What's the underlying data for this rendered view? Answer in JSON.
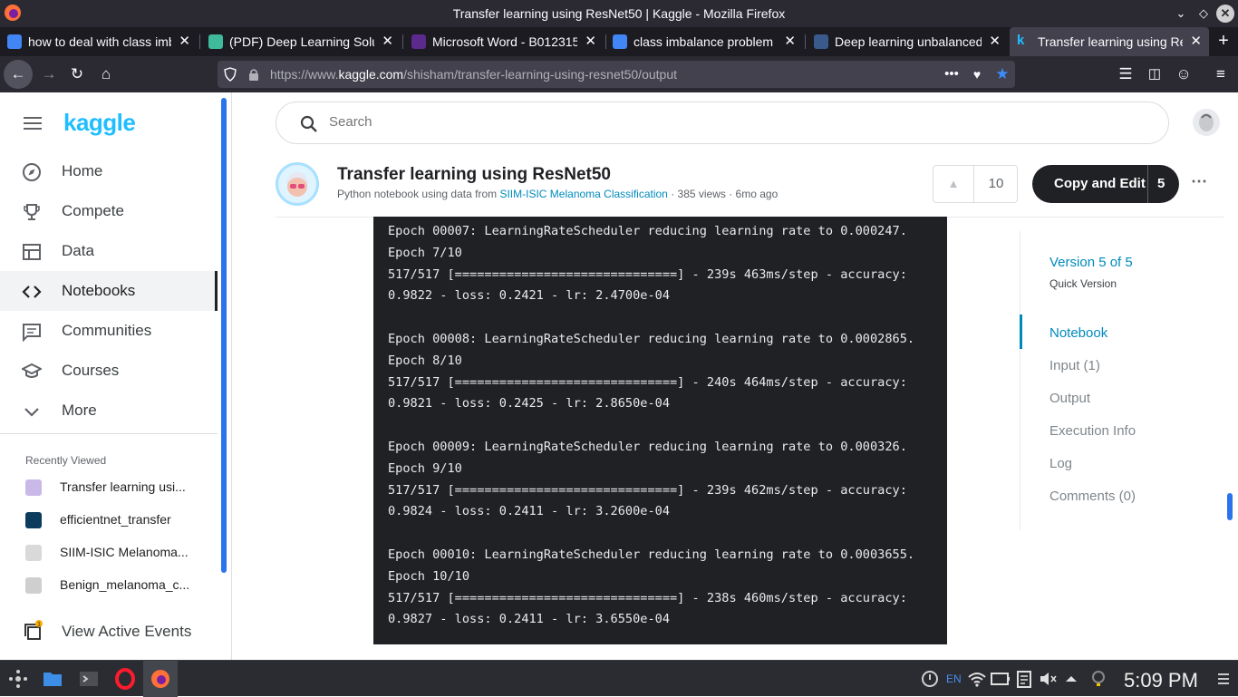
{
  "window": {
    "title": "Transfer learning using ResNet50 | Kaggle - Mozilla Firefox"
  },
  "tabs": [
    {
      "label": "how to deal with class imb",
      "favicon_color": "#4285f4",
      "active": false
    },
    {
      "label": "(PDF) Deep Learning Solut",
      "favicon_color": "#40ba9c",
      "active": false
    },
    {
      "label": "Microsoft Word - B012315",
      "favicon_color": "#5b2a8c",
      "active": false
    },
    {
      "label": "class imbalance problem i",
      "favicon_color": "#4285f4",
      "active": false
    },
    {
      "label": "Deep learning unbalanced",
      "favicon_color": "#3a5a8c",
      "active": false
    },
    {
      "label": "Transfer learning using Re",
      "favicon_color": "#20beff",
      "active": true
    }
  ],
  "navbar": {
    "url_prefix": "https://www.",
    "url_domain": "kaggle.com",
    "url_path": "/shisham/transfer-learning-using-resnet50/output"
  },
  "sidebar": {
    "logo": "kaggle",
    "items": [
      {
        "label": "Home",
        "icon": "compass-icon",
        "active": false
      },
      {
        "label": "Compete",
        "icon": "trophy-icon",
        "active": false
      },
      {
        "label": "Data",
        "icon": "table-icon",
        "active": false
      },
      {
        "label": "Notebooks",
        "icon": "code-icon",
        "active": true
      },
      {
        "label": "Communities",
        "icon": "chat-icon",
        "active": false
      },
      {
        "label": "Courses",
        "icon": "school-icon",
        "active": false
      },
      {
        "label": "More",
        "icon": "chevron-down-icon",
        "active": false
      }
    ],
    "recently_viewed_title": "Recently Viewed",
    "recently_viewed": [
      {
        "label": "Transfer learning usi...",
        "thumb_color": "#c9b8e8"
      },
      {
        "label": "efficientnet_transfer",
        "thumb_color": "#0b3c5d"
      },
      {
        "label": "SIIM-ISIC Melanoma...",
        "thumb_color": "#d9d9d9"
      },
      {
        "label": "Benign_melanoma_c...",
        "thumb_color": "#cfcfcf"
      }
    ],
    "events_label": "View Active Events",
    "events_badge": "1"
  },
  "search": {
    "placeholder": "Search"
  },
  "notebook": {
    "title": "Transfer learning using ResNet50",
    "subtitle_prefix": "Python notebook using data from",
    "dataset_link": "SIIM-ISIC Melanoma Classification",
    "subtitle_suffix": "· 385 views · 6mo ago",
    "votes": "10",
    "copy_edit_label": "Copy and Edit",
    "copy_edit_count": "5"
  },
  "console_lines": [
    "Epoch 00007: LearningRateScheduler reducing learning rate to 0.000247.",
    "Epoch 7/10",
    "517/517 [==============================] - 239s 463ms/step - accuracy:",
    "0.9822 - loss: 0.2421 - lr: 2.4700e-04",
    "",
    "Epoch 00008: LearningRateScheduler reducing learning rate to 0.0002865.",
    "Epoch 8/10",
    "517/517 [==============================] - 240s 464ms/step - accuracy:",
    "0.9821 - loss: 0.2425 - lr: 2.8650e-04",
    "",
    "Epoch 00009: LearningRateScheduler reducing learning rate to 0.000326.",
    "Epoch 9/10",
    "517/517 [==============================] - 239s 462ms/step - accuracy:",
    "0.9824 - loss: 0.2411 - lr: 3.2600e-04",
    "",
    "Epoch 00010: LearningRateScheduler reducing learning rate to 0.0003655.",
    "Epoch 10/10",
    "517/517 [==============================] - 238s 460ms/step - accuracy:",
    "0.9827 - loss: 0.2411 - lr: 3.6550e-04"
  ],
  "toc": {
    "version": "Version 5 of 5",
    "quick_version": "Quick Version",
    "items": [
      {
        "label": "Notebook",
        "active": true
      },
      {
        "label": "Input (1)",
        "active": false
      },
      {
        "label": "Output",
        "active": false
      },
      {
        "label": "Execution Info",
        "active": false
      },
      {
        "label": "Log",
        "active": false
      },
      {
        "label": "Comments (0)",
        "active": false
      }
    ]
  },
  "taskbar": {
    "clock": "5:09 PM",
    "lang": "EN"
  },
  "colors": {
    "kaggle_blue": "#20beff",
    "link_blue": "#008abc",
    "console_bg": "#1f2124"
  }
}
